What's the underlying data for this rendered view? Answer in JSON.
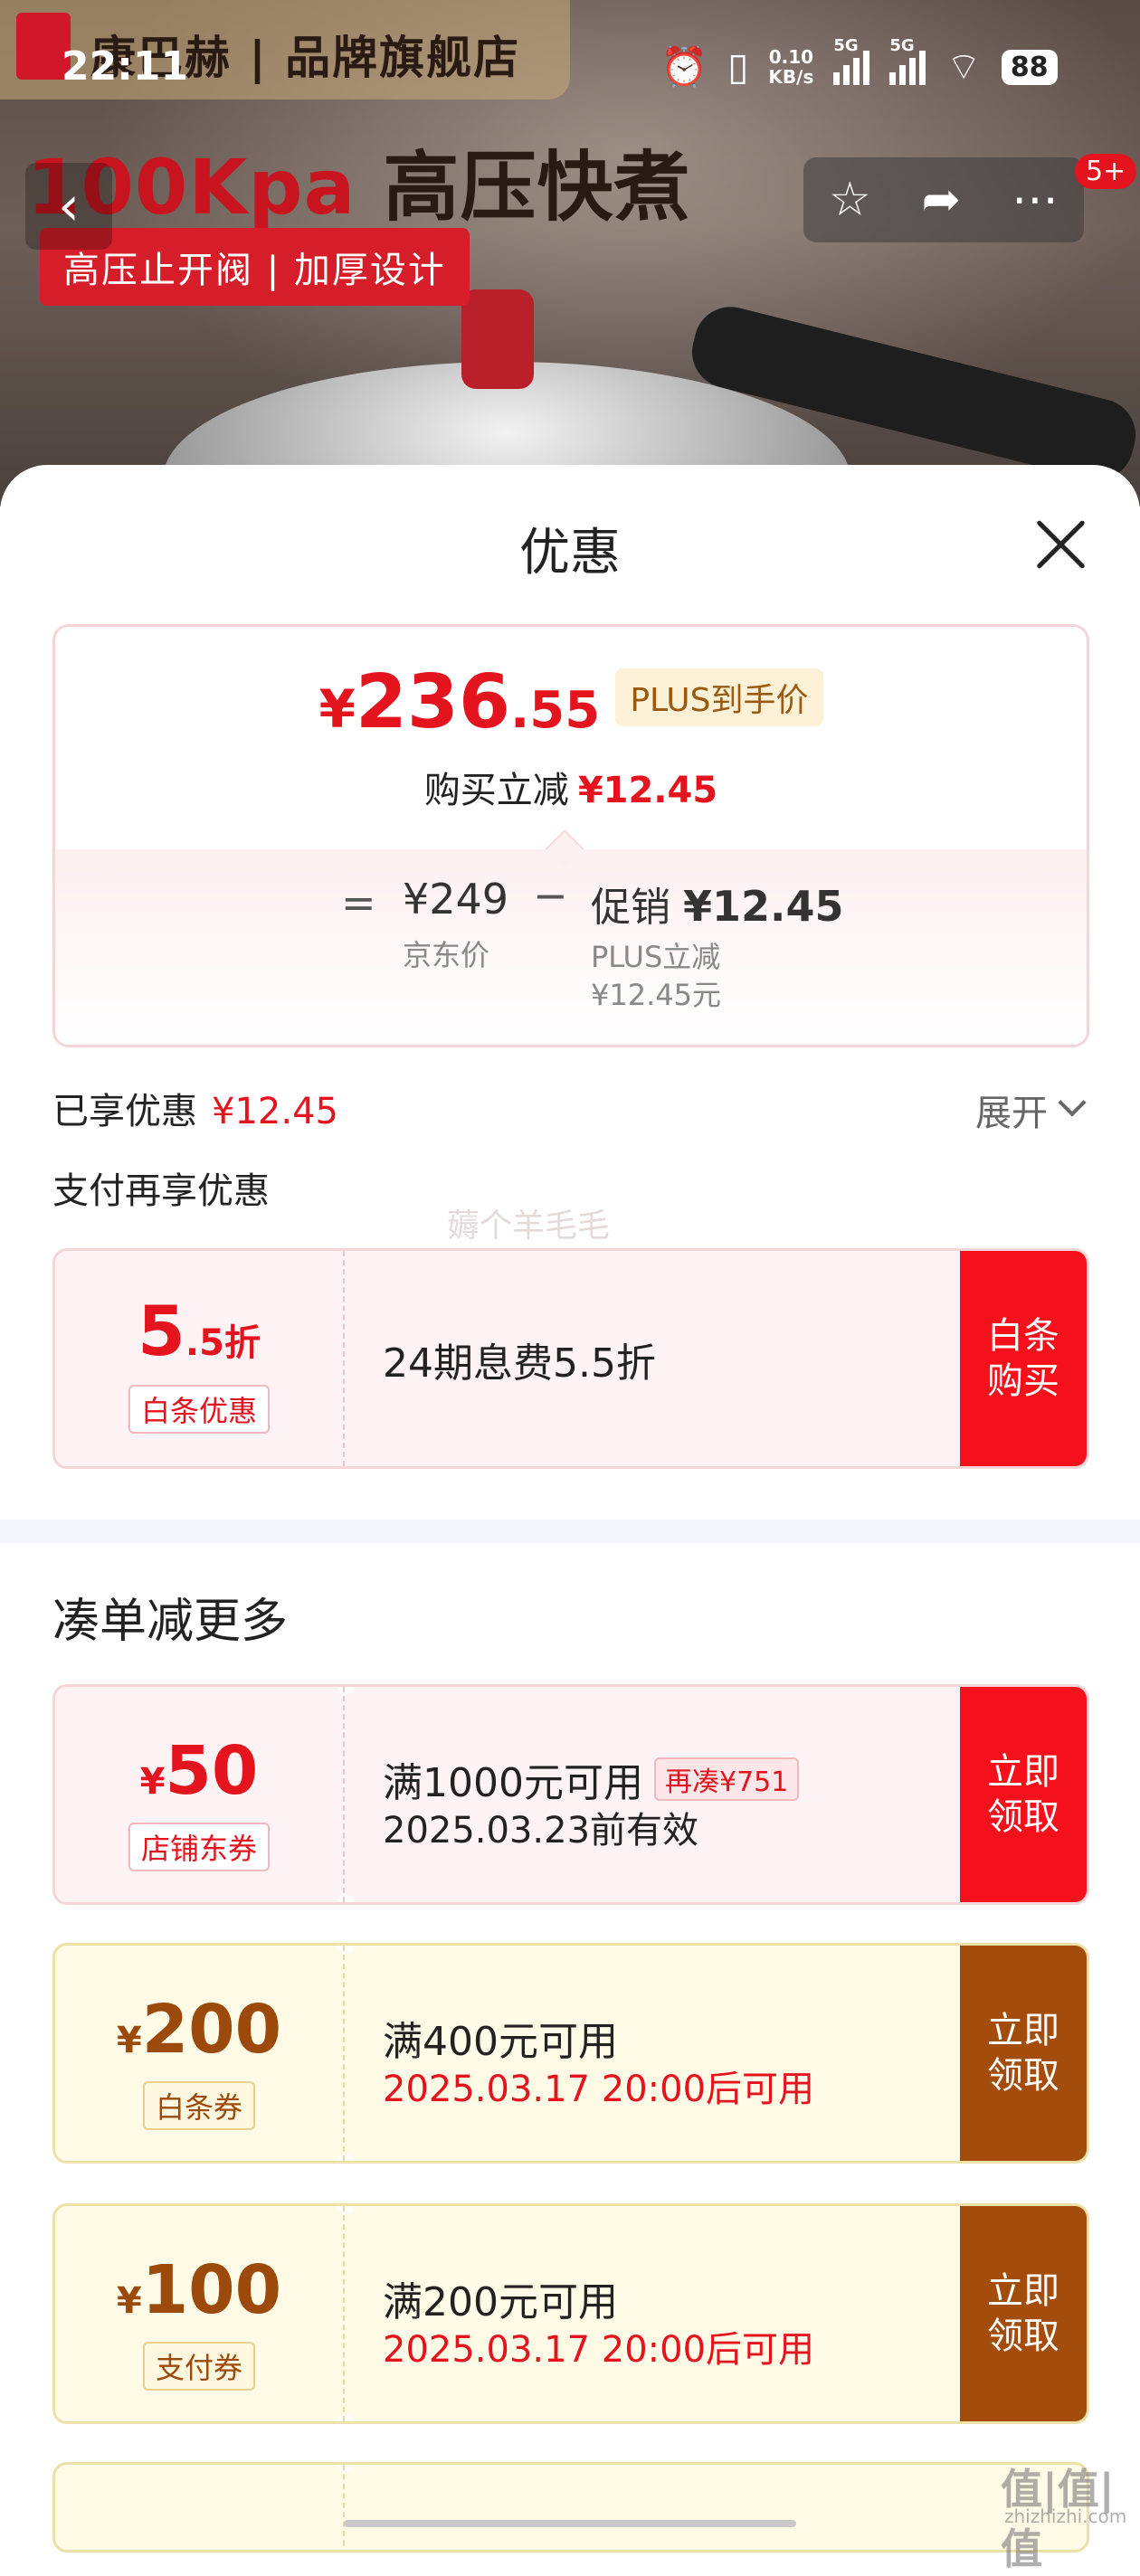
{
  "status_bar": {
    "time": "22:11",
    "net_speed_value": "0.10",
    "net_speed_unit": "KB/s",
    "sim1": "5G",
    "sim2": "5G",
    "battery": "88"
  },
  "banner": {
    "brand": "康巴赫 | 品牌旗舰店",
    "headline_en": "100Kpa",
    "headline_cn": "高压快煮",
    "subtag": "高压止开阀 | 加厚设计",
    "badge": "5+"
  },
  "sheet": {
    "title": "优惠"
  },
  "price_card": {
    "currency": "¥",
    "price_int": "236",
    "price_dec": ".55",
    "plus_tag": "PLUS到手价",
    "save_label": "购买立减",
    "save_value": "¥12.45",
    "eq": "=",
    "jd_price": "¥249",
    "jd_label": "京东价",
    "minus": "−",
    "promo_label": "促销",
    "promo_value": "¥12.45",
    "promo_sub1": "PLUS立减",
    "promo_sub2": "¥12.45元"
  },
  "enjoyed": {
    "label": "已享优惠",
    "value": "¥12.45",
    "expand": "展开"
  },
  "pay_more": "支付再享优惠",
  "watermark": "薅个羊毛毛",
  "baitiao": {
    "value_big": "5",
    "value_small": ".5折",
    "tag": "白条优惠",
    "desc": "24期息费5.5折",
    "button": "白条购买"
  },
  "section_title": "凑单减更多",
  "coupons": [
    {
      "symbol": "¥",
      "amount": "50",
      "tag": "店铺东券",
      "desc": "满1000元可用",
      "extra": "再凑¥751",
      "date": "2025.03.23前有效",
      "button": "立即领取"
    },
    {
      "symbol": "¥",
      "amount": "200",
      "tag": "白条券",
      "desc": "满400元可用",
      "date": "2025.03.17 20:00后可用",
      "button": "立即领取"
    },
    {
      "symbol": "¥",
      "amount": "100",
      "tag": "支付券",
      "desc": "满200元可用",
      "date": "2025.03.17 20:00后可用",
      "button": "立即领取"
    }
  ],
  "site_watermark": {
    "logo": "值|值|值",
    "url": "zhizhizhi.com"
  },
  "colors": {
    "accent_red": "#e4141e",
    "button_red": "#f5111c",
    "gold_button": "#a34c0b",
    "gold_text": "#9c4a0c"
  }
}
